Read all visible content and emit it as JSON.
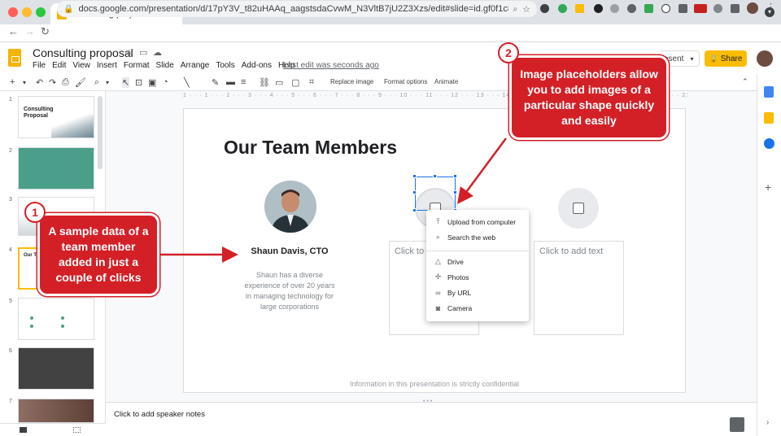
{
  "browser": {
    "tab_title": "Consulting proposal - Google Sl",
    "tab_close": "×",
    "new_tab": "+",
    "url": "docs.google.com/presentation/d/17pY3V_t82uHAAq_aagstsdaCvwM_N3VltB7jU2Z3Xzs/edit#slide=id.gf0f1c8062..."
  },
  "header": {
    "doc_title": "Consulting proposal",
    "menus": [
      "File",
      "Edit",
      "View",
      "Insert",
      "Format",
      "Slide",
      "Arrange",
      "Tools",
      "Add-ons",
      "Help"
    ],
    "last_edit": "Last edit was seconds ago",
    "present_label": "esent",
    "share_label": "Share"
  },
  "toolbar": {
    "replace_image": "Replace image",
    "format_options": "Format options",
    "animate": "Animate",
    "ruler": "1 · · · 1 · · · 2 · · · 3 · · · 4 · · · 5 · · · 6 · · · 7 · · · 8 · · · 9 · · · 10 · · · 11 · · · 12 · · · 13 · · · 14 · · · 15 · · · 16 · · · 17 · · · 18 · · · 19 · · · 20 · · · 21 · · · 22 · · · 23 · · · 24 · · · 25"
  },
  "filmstrip": {
    "numbers": [
      "1",
      "2",
      "3",
      "4",
      "5",
      "6",
      "7"
    ],
    "thumb1_title": "Consulting Proposal",
    "thumb4_title": "Our Te"
  },
  "slide": {
    "title": "Our Team Members",
    "member_name": "Shaun Davis, CTO",
    "member_desc": "Shaun has a diverse experience of over 20 years in managing technology for large corporations",
    "placeholder_text_1": "Click to a",
    "placeholder_text_2": "Click to add text",
    "footnote": "Information in this presentation is strictly confidential"
  },
  "image_menu": {
    "items": [
      "Upload from computer",
      "Search the web",
      "Drive",
      "Photos",
      "By URL",
      "Camera"
    ]
  },
  "notes": {
    "placeholder": "Click to add speaker notes"
  },
  "annotations": {
    "callout1_number": "1",
    "callout1_text": "A sample data of a team member added in just a couple of clicks",
    "callout2_number": "2",
    "callout2_text": "Image placeholders allow you to add images of a particular shape quickly and easily"
  },
  "colors": {
    "accent_red": "#d32027",
    "slides_yellow": "#f4b400",
    "share_yellow": "#fbbc04",
    "selection_blue": "#1a73e8",
    "theme_green": "#4a9f8a"
  }
}
